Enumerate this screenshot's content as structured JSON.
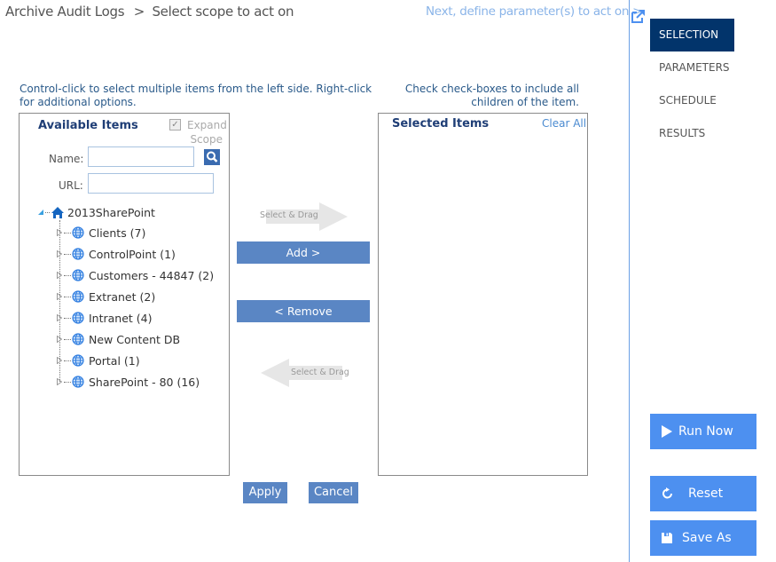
{
  "header": {
    "title": "Archive Audit Logs",
    "separator": ">",
    "subtitle": "Select scope to act on",
    "next_link": "Next, define parameter(s) to act on >"
  },
  "nav": {
    "items": [
      {
        "label": "SELECTION",
        "active": true
      },
      {
        "label": "PARAMETERS",
        "active": false
      },
      {
        "label": "SCHEDULE",
        "active": false
      },
      {
        "label": "RESULTS",
        "active": false
      }
    ]
  },
  "hints": {
    "left": "Control-click to select multiple items from the left side. Right-click for additional options.",
    "right": "Check check-boxes to include all children of the item."
  },
  "available": {
    "title": "Available Items",
    "expand_scope_label": "Expand Scope",
    "expand_scope_checked": true,
    "name_label": "Name:",
    "name_value": "",
    "url_label": "URL:",
    "url_value": "",
    "tree": {
      "root": "2013SharePoint",
      "children": [
        "Clients (7)",
        "ControlPoint (1)",
        "Customers - 44847 (2)",
        "Extranet (2)",
        "Intranet (4)",
        "New Content DB",
        "Portal (1)",
        "SharePoint - 80 (16)"
      ]
    }
  },
  "transfer": {
    "drag_hint_top": "Select & Drag",
    "add_label": "Add >",
    "remove_label": "< Remove",
    "drag_hint_bottom": "Select & Drag"
  },
  "selected": {
    "title": "Selected Items",
    "clear_all": "Clear All",
    "items": []
  },
  "footer": {
    "apply_label": "Apply",
    "cancel_label": "Cancel"
  },
  "actions": {
    "run_now": "Run Now",
    "reset": "Reset",
    "save_as": "Save As"
  },
  "colors": {
    "nav_active": "#02346b",
    "action_button": "#4d90f0",
    "transfer_button": "#5a86c4",
    "accent_line": "#6aa0e6"
  }
}
